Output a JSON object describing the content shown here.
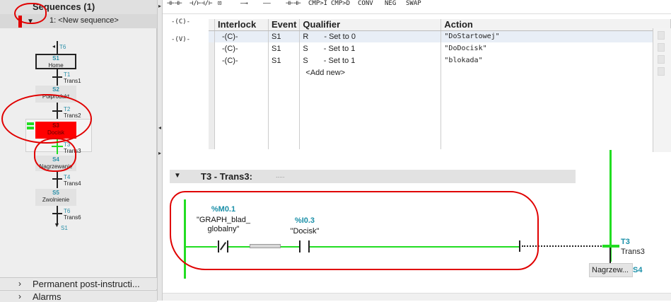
{
  "navigation": {
    "sequences_title": "Sequences (1)",
    "sequence_name": "1: <New sequence>",
    "steps": [
      {
        "id": "S1",
        "label": "Home"
      },
      {
        "id": "S2",
        "label": "Półprodukt"
      },
      {
        "id": "S3",
        "label": "Docisk"
      },
      {
        "id": "S4",
        "label": "Nagrzewanie"
      },
      {
        "id": "S5",
        "label": "Zwolnienie"
      }
    ],
    "transitions": [
      {
        "id": "T1",
        "label": "Trans1"
      },
      {
        "id": "T2",
        "label": "Trans2"
      },
      {
        "id": "T3",
        "label": "Trans3"
      },
      {
        "id": "T4",
        "label": "Trans4"
      },
      {
        "id": "T6",
        "label": "Trans6"
      }
    ],
    "jump_top": "T6",
    "jump_bottom": "S1",
    "panels": [
      {
        "label": "Permanent post-instructi..."
      },
      {
        "label": "Alarms"
      }
    ]
  },
  "toolbar": {
    "buttons": [
      "⊣⊢⊣⊢",
      "⊣/⊢⊣/⊢",
      "⊡",
      "—→",
      "——",
      "⊣⊢⊣⊢",
      "CMP>I",
      "CMP>D",
      "CONV",
      "NEG",
      "SWAP"
    ]
  },
  "interlock_symbols": [
    "-(C)-",
    "-(V)-"
  ],
  "action_table": {
    "headers": [
      "Interlock",
      "Event",
      "Qualifier",
      "Action"
    ],
    "rows": [
      {
        "interlock": "-(C)-",
        "event": "S1",
        "qualifier": "R",
        "qualifier_desc": "- Set to 0",
        "action": "\"DoStartowej\""
      },
      {
        "interlock": "-(C)-",
        "event": "S1",
        "qualifier": "S",
        "qualifier_desc": "- Set to 1",
        "action": "\"DoDocisk\""
      },
      {
        "interlock": "-(C)-",
        "event": "S1",
        "qualifier": "S",
        "qualifier_desc": "- Set to 1",
        "action": "\"blokada\""
      }
    ],
    "add_new": "<Add new>"
  },
  "network": {
    "title": "T3 - Trans3:",
    "comment": "....."
  },
  "ladder": {
    "contact1": {
      "address": "%M0.1",
      "name": "\"GRAPH_blad_\nglobalny\""
    },
    "contact2": {
      "address": "%I0.3",
      "name": "\"Docisk\""
    },
    "transition": {
      "id": "T3",
      "label": "Trans3"
    },
    "next_step": {
      "label": "Nagrzew...",
      "id": "S4"
    }
  },
  "colors": {
    "accent_teal": "#2a8fa8",
    "power_rail": "#22dd22",
    "active_step": "#ff0000",
    "annotation": "#e00000"
  }
}
